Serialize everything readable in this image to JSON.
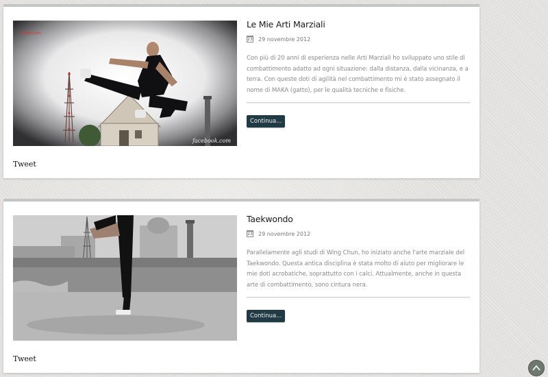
{
  "posts": [
    {
      "title": "Le Mie Arti Marziali",
      "date_day": "23",
      "date": "29 novembre 2012",
      "excerpt": "Con più di 20 anni di esperienza nelle Arti Marziali ho sviluppato uno stile di combattimento adatto ad ogni situazione: dalla distanza, dalla vicinanza, e a terra. Con queste doti di agilità nel combattimento mi è stato assegnato il nome di MAKA (gatto), per le qualità tecniche e fisiche.",
      "more_label": "Continua...",
      "tweet_label": "Tweet",
      "image_watermark": "facebook.com",
      "image_corner_text": "www.com"
    },
    {
      "title": "Taekwondo",
      "date_day": "23",
      "date": "29 novembre 2012",
      "excerpt": "Parallelamente agli studi di Wing Chun, ho iniziato anche l'arte marziale del Taekwondo. Questa antica disciplina è stata molto di aiuto per migliorare le mie doti acrobatiche, soprattutto con i calci. Attualmente, anche in questa arte di combattimento, sono cintura nera.",
      "more_label": "Continua...",
      "tweet_label": "Tweet"
    }
  ],
  "icons": {
    "calendar": "calendar-icon",
    "back_to_top": "chevron-up-icon"
  },
  "colors": {
    "button_bg": "#213a43",
    "excerpt_text": "#8b8b8b",
    "page_bg": "#e4e3e1"
  }
}
